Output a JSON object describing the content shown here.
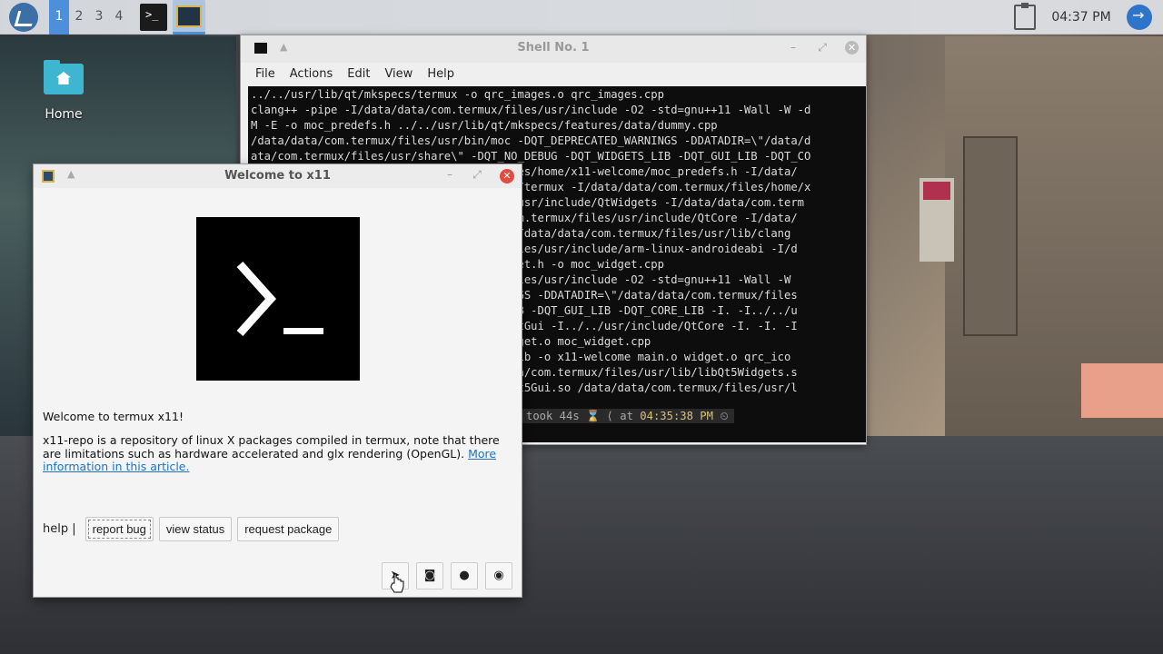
{
  "panel": {
    "workspaces": [
      "1",
      "2",
      "3",
      "4"
    ],
    "active_workspace": "1",
    "clock": "04:37 PM"
  },
  "desktop": {
    "home_label": "Home"
  },
  "terminal": {
    "title": "Shell No. 1",
    "menu": [
      "File",
      "Actions",
      "Edit",
      "View",
      "Help"
    ],
    "lines": [
      "../../usr/lib/qt/mkspecs/termux -o qrc_images.o qrc_images.cpp",
      "clang++ -pipe -I/data/data/com.termux/files/usr/include -O2 -std=gnu++11 -Wall -W -d",
      "M -E -o moc_predefs.h ../../usr/lib/qt/mkspecs/features/data/dummy.cpp",
      "/data/data/com.termux/files/usr/bin/moc -DQT_DEPRECATED_WARNINGS -DDATADIR=\\\"/data/d",
      "ata/com.termux/files/usr/share\\\" -DQT_NO_DEBUG -DQT_WIDGETS_LIB -DQT_GUI_LIB -DQT_CO",
      "                                   x/files/home/x11-welcome/moc_predefs.h -I/data/",
      "                                   specs/termux -I/data/data/com.termux/files/home/x",
      "                                   iles/usr/include/QtWidgets -I/data/data/com.term",
      "                                   ta/com.termux/files/usr/include/QtCore -I/data/",
      "                                   v1 -I/data/data/com.termux/files/usr/lib/clang",
      "                                   ux/files/usr/include/arm-linux-androideabi -I/d",
      "                                    widget.h -o moc_widget.cpp",
      "                                   ux/files/usr/include -O2 -std=gnu++11 -Wall -W",
      "                                   ARNINGS -DDATADIR=\\\"/data/data/com.termux/files",
      "                                   TS_LIB -DQT_GUI_LIB -DQT_CORE_LIB -I. -I../../u",
      "                                   ude/QtGui -I../../usr/include/QtCore -I. -I. -I",
      "                                   c_widget.o moc_widget.cpp",
      "                                   usr/lib -o x11-welcome main.o widget.o qrc_ico",
      "                                   s/data/com.termux/files/usr/lib/libQt5Widgets.s",
      "                                   /libQt5Gui.so /data/data/com.termux/files/usr/l"
    ],
    "prompt_took": "took 44s",
    "prompt_at": "at",
    "prompt_time": "04:35:38 PM"
  },
  "welcome": {
    "title": "Welcome to x11",
    "heading": "Welcome to termux x11!",
    "description": "x11-repo is a repository of linux X packages compiled in termux, note that there are limitations such as hardware accelerated and glx rendering (OpenGL). ",
    "link_text": "More information in this article.",
    "help_label": "help |",
    "buttons": [
      "report bug",
      "view status",
      "request package"
    ]
  }
}
